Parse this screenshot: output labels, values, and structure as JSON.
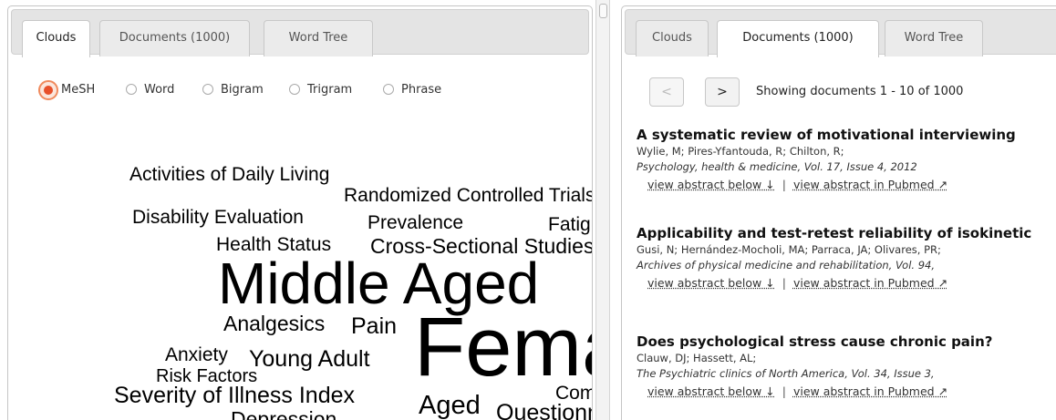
{
  "left": {
    "tabs": [
      {
        "label": "Clouds"
      },
      {
        "label": "Documents (1000)"
      },
      {
        "label": "Word Tree"
      }
    ],
    "active_tab": "Clouds",
    "radio_options": [
      {
        "label": "MeSH",
        "checked": true
      },
      {
        "label": "Word",
        "checked": false
      },
      {
        "label": "Bigram",
        "checked": false
      },
      {
        "label": "Trigram",
        "checked": false
      },
      {
        "label": "Phrase",
        "checked": false
      }
    ],
    "cloud_words": [
      "Activities of Daily Living",
      "Randomized Controlled Trials",
      "Disability Evaluation",
      "Prevalence",
      "Fatigue",
      "Health Status",
      "Cross-Sectional Studies",
      "Middle Aged",
      "Analgesics",
      "Pain",
      "Female",
      "Anxiety",
      "Young Adult",
      "Risk Factors",
      "Severity of Illness Index",
      "Aged",
      "Com",
      "Questionnaires",
      "Depression"
    ]
  },
  "right": {
    "tabs": [
      {
        "label": "Clouds"
      },
      {
        "label": "Documents (1000)"
      },
      {
        "label": "Word Tree"
      }
    ],
    "active_tab": "Documents (1000)",
    "pager": {
      "prev_label": "<",
      "next_label": ">",
      "status": "Showing documents 1 - 10 of 1000"
    },
    "documents": [
      {
        "title": "A systematic review of motivational interviewing",
        "authors": "Wylie, M; Pires-Yfantouda, R; Chilton, R;",
        "journal": "Psychology, health & medicine, Vol. 17, Issue 4, 2012",
        "link_abstract": "view abstract below ↓",
        "link_pubmed": "view abstract in Pubmed ↗"
      },
      {
        "title": "Applicability and test-retest reliability of isokinetic",
        "authors": "Gusi, N; Hernández-Mocholi, MA; Parraca, JA; Olivares, PR;",
        "journal": "Archives of physical medicine and rehabilitation, Vol. 94,",
        "link_abstract": "view abstract below ↓",
        "link_pubmed": "view abstract in Pubmed ↗"
      },
      {
        "title": "Does psychological stress cause chronic pain?",
        "authors": "Clauw, DJ; Hassett, AL;",
        "journal": "The Psychiatric clinics of North America, Vol. 34, Issue 3,",
        "link_abstract": "view abstract below ↓",
        "link_pubmed": "view abstract in Pubmed ↗"
      }
    ],
    "link_separator": "|"
  },
  "colors": {
    "radio_accent": "#e8502a",
    "tab_bar": "#e4e4e4"
  }
}
